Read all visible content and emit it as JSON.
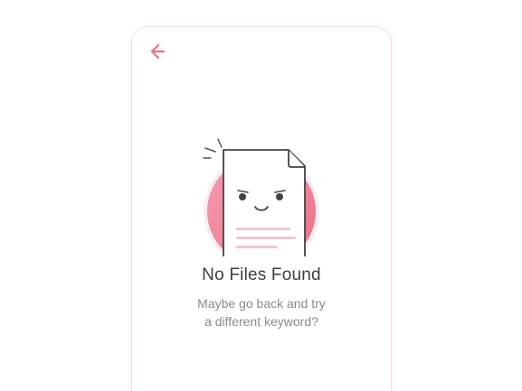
{
  "empty_state": {
    "back_icon": "arrow-left-icon",
    "illustration_icon": "sad-document-icon",
    "title": "No Files Found",
    "message_line_1": "Maybe go back and try",
    "message_line_2": "a different keyword?"
  },
  "colors": {
    "accent": "#ee6f86",
    "accent_light": "#f7d9df",
    "text_primary": "#3e3e3e",
    "text_secondary": "#8a8a8a"
  }
}
